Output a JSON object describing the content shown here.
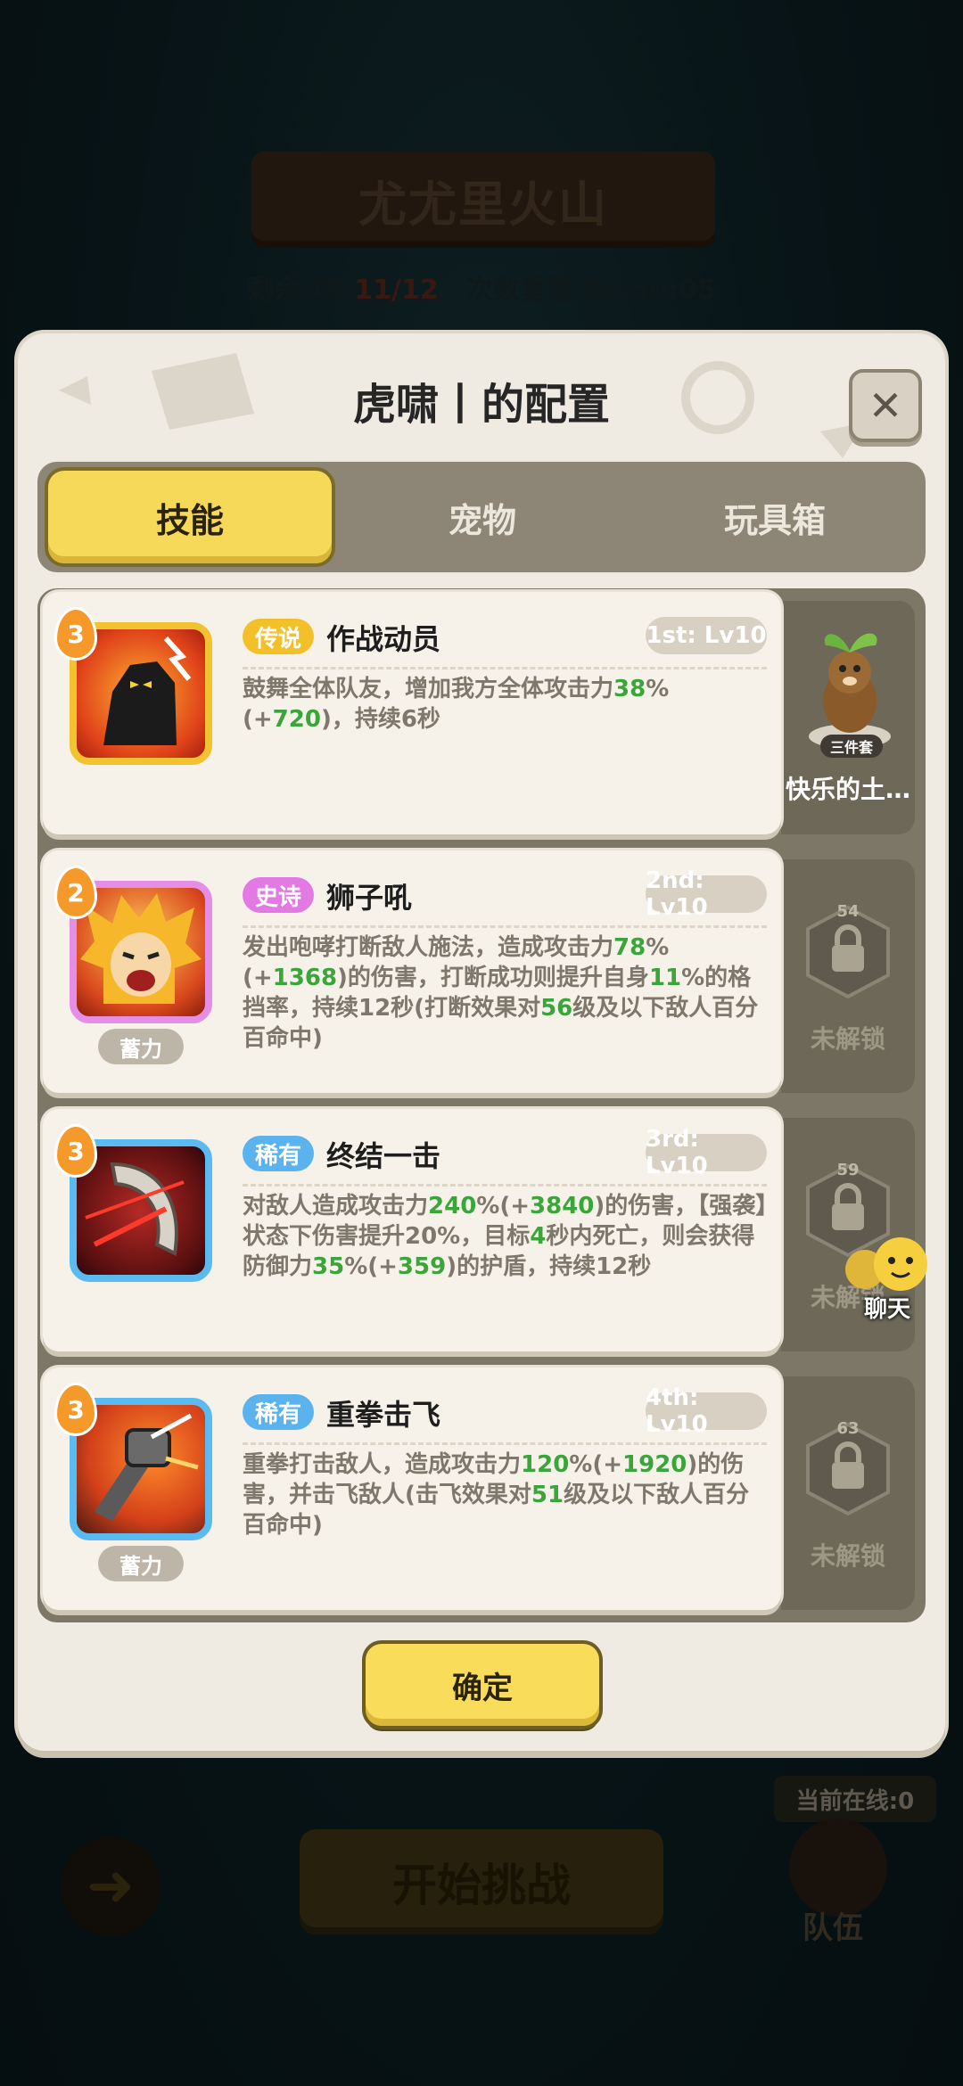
{
  "background": {
    "stage_title": "尤尤里火山",
    "remain_label": "剩余次数",
    "remain_value": "11/12",
    "reset_label": "次数重置",
    "reset_time": "08:50:05",
    "online_text": "当前在线:0",
    "team_label": "队伍",
    "start_button": "开始挑战"
  },
  "modal": {
    "title": "虎啸丨的配置",
    "close_glyph": "✕",
    "tabs": [
      {
        "label": "技能",
        "active": true
      },
      {
        "label": "宠物",
        "active": false
      },
      {
        "label": "玩具箱",
        "active": false
      }
    ],
    "skills": [
      {
        "level": "3",
        "rarity": "传说",
        "rarity_type": "legend",
        "name": "作战动员",
        "slot": "1st: Lv10",
        "charge": "",
        "desc": [
          {
            "t": "鼓舞全体队友，增加我方全体攻击力"
          },
          {
            "t": "38",
            "g": true
          },
          {
            "t": "%(+"
          },
          {
            "t": "720",
            "g": true
          },
          {
            "t": ")，持续6秒"
          }
        ]
      },
      {
        "level": "2",
        "rarity": "史诗",
        "rarity_type": "epic",
        "name": "狮子吼",
        "slot": "2nd: Lv10",
        "charge": "蓄力",
        "desc": [
          {
            "t": "发出咆哮打断敌人施法，造成攻击力"
          },
          {
            "t": "78",
            "g": true
          },
          {
            "t": "%(+"
          },
          {
            "t": "1368",
            "g": true
          },
          {
            "t": ")的伤害，打断成功则提升自身"
          },
          {
            "t": "11",
            "g": true
          },
          {
            "t": "%的格挡率，持续12秒(打断效果对"
          },
          {
            "t": "56",
            "g": true
          },
          {
            "t": "级及以下敌人百分百命中)"
          }
        ]
      },
      {
        "level": "3",
        "rarity": "稀有",
        "rarity_type": "rare",
        "name": "终结一击",
        "slot": "3rd: Lv10",
        "charge": "",
        "desc": [
          {
            "t": "对敌人造成攻击力"
          },
          {
            "t": "240",
            "g": true
          },
          {
            "t": "%(+"
          },
          {
            "t": "3840",
            "g": true
          },
          {
            "t": ")的伤害，【强袭】状态下伤害提升20%，目标"
          },
          {
            "t": "4",
            "g": true
          },
          {
            "t": "秒内死亡，则会获得防御力"
          },
          {
            "t": "35",
            "g": true
          },
          {
            "t": "%(+"
          },
          {
            "t": "359",
            "g": true
          },
          {
            "t": ")的护盾，持续12秒"
          }
        ]
      },
      {
        "level": "3",
        "rarity": "稀有",
        "rarity_type": "rare",
        "name": "重拳击飞",
        "slot": "4th: Lv10",
        "charge": "蓄力",
        "desc": [
          {
            "t": "重拳打击敌人，造成攻击力"
          },
          {
            "t": "120",
            "g": true
          },
          {
            "t": "%(+"
          },
          {
            "t": "1920",
            "g": true
          },
          {
            "t": ")的伤害，并击飞敌人(击飞效果对"
          },
          {
            "t": "51",
            "g": true
          },
          {
            "t": "级及以下敌人百分百命中)"
          }
        ]
      }
    ],
    "side_slots": [
      {
        "type": "pet",
        "set_tag": "三件套",
        "name": "快乐的土…"
      },
      {
        "type": "locked",
        "unlock_level": "54",
        "label": "未解锁"
      },
      {
        "type": "locked",
        "unlock_level": "59",
        "label": "未解锁"
      },
      {
        "type": "locked",
        "unlock_level": "63",
        "label": "未解锁"
      }
    ],
    "confirm_button": "确定"
  },
  "chat": {
    "label": "聊天"
  },
  "colors": {
    "accent_yellow": "#f7d95a",
    "legend": "#f3c02a",
    "epic": "#e379e3",
    "rare": "#5ab3ee",
    "value_green": "#3aa63a"
  }
}
